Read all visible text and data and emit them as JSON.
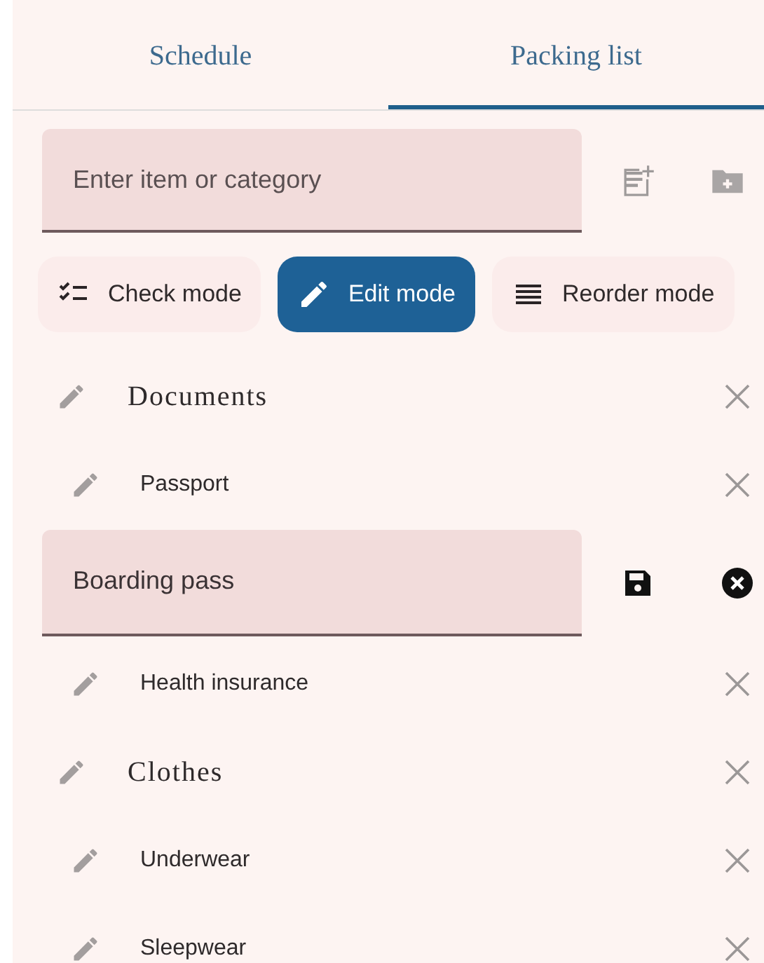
{
  "tabs": [
    {
      "label": "Schedule",
      "selected": false
    },
    {
      "label": "Packing list",
      "selected": true
    }
  ],
  "entry": {
    "placeholder": "Enter item or category"
  },
  "modes": [
    {
      "label": "Check mode",
      "kind": "check",
      "selected": false
    },
    {
      "label": "Edit mode",
      "kind": "edit",
      "selected": true
    },
    {
      "label": "Reorder mode",
      "kind": "reorder",
      "selected": false
    }
  ],
  "categories": [
    {
      "name": "Documents",
      "editing": false,
      "children": [
        {
          "name": "Passport",
          "editing": false
        },
        {
          "name": "Boarding pass",
          "editing": true
        },
        {
          "name": "Health insurance",
          "editing": false
        }
      ]
    },
    {
      "name": "Clothes",
      "editing": false,
      "children": [
        {
          "name": "Underwear",
          "editing": false
        },
        {
          "name": "Sleepwear",
          "editing": false
        }
      ]
    }
  ]
}
